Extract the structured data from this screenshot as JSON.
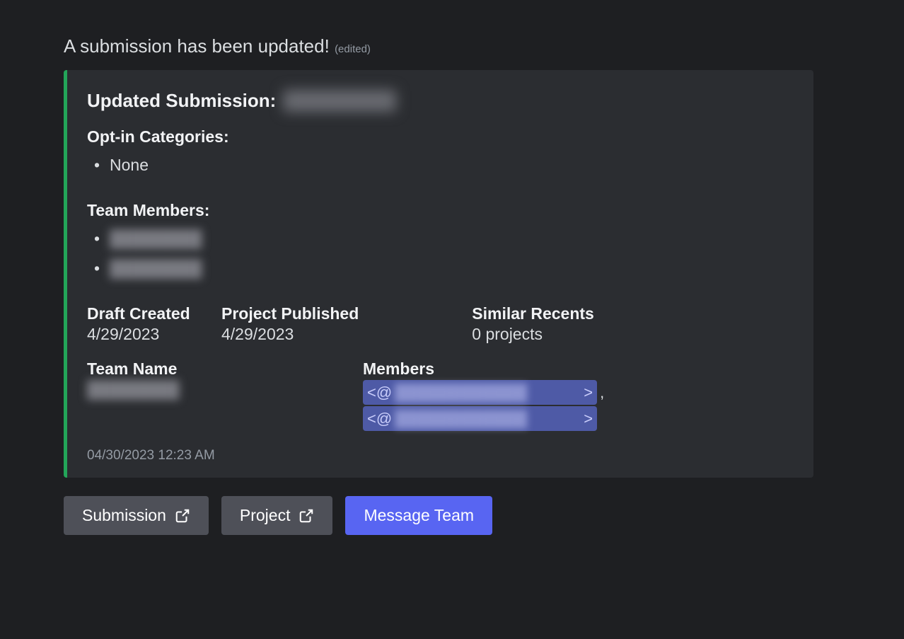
{
  "header": {
    "text": "A submission has been updated!",
    "edited": "(edited)"
  },
  "embed": {
    "title_prefix": "Updated Submission:",
    "title_redacted": "████████",
    "optin_label": "Opt-in Categories:",
    "optin_items": [
      "None"
    ],
    "team_members_label": "Team Members:",
    "team_members": [
      "████████",
      "████████"
    ],
    "fields": {
      "draft_created": {
        "label": "Draft Created",
        "value": "4/29/2023"
      },
      "project_published": {
        "label": "Project Published",
        "value": "4/29/2023"
      },
      "similar_recents": {
        "label": "Similar Recents",
        "value": "0 projects"
      },
      "team_name": {
        "label": "Team Name",
        "value": "████████"
      },
      "members": {
        "label": "Members"
      }
    },
    "member_mentions": [
      {
        "prefix": "<@",
        "mid": "████████████",
        "suffix": ">",
        "trailing": ","
      },
      {
        "prefix": "<@",
        "mid": "████████████",
        "suffix": ">",
        "trailing": ""
      }
    ],
    "footer_timestamp": "04/30/2023 12:23 AM"
  },
  "buttons": {
    "submission": "Submission",
    "project": "Project",
    "message_team": "Message Team"
  }
}
